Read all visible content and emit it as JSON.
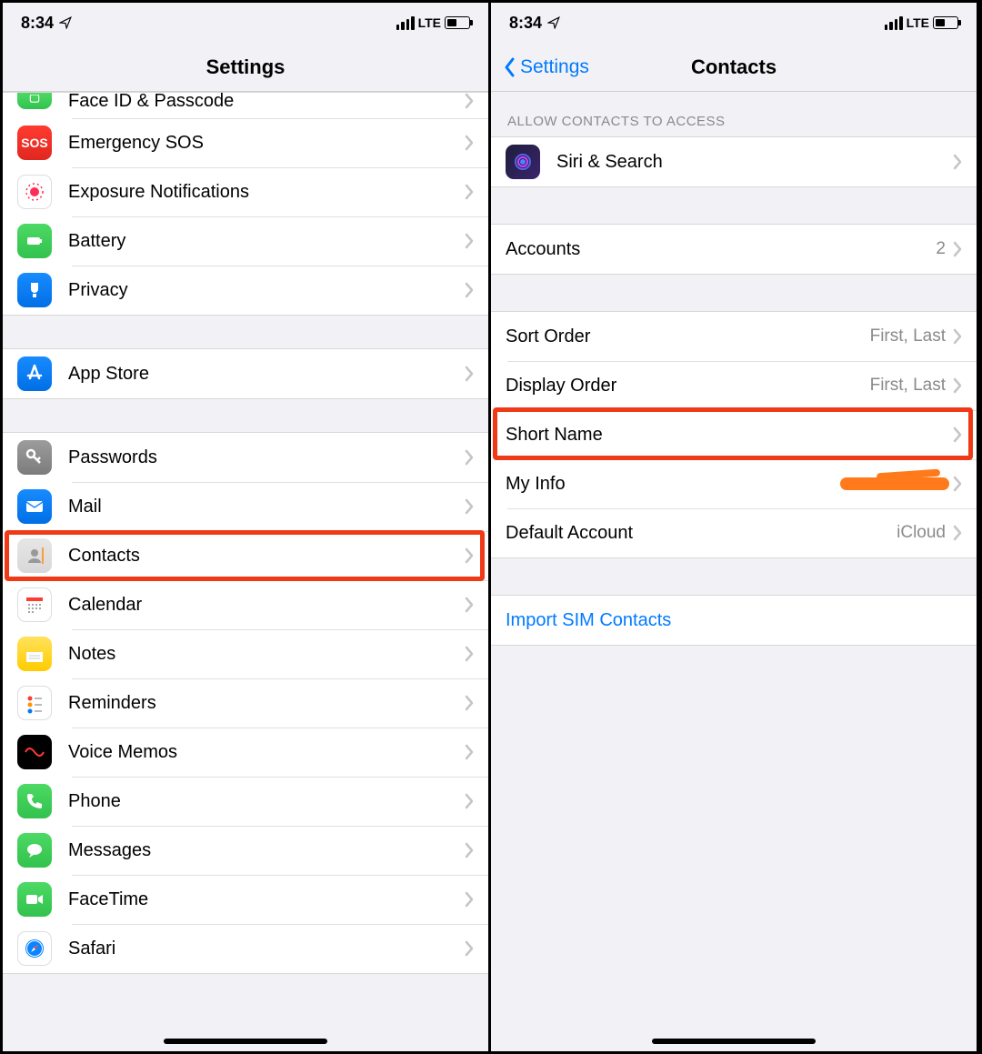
{
  "status": {
    "time": "8:34",
    "network": "LTE"
  },
  "left": {
    "title": "Settings",
    "items": [
      {
        "label": "Face ID & Passcode",
        "cut": true
      },
      {
        "label": "Emergency SOS"
      },
      {
        "label": "Exposure Notifications"
      },
      {
        "label": "Battery"
      },
      {
        "label": "Privacy"
      }
    ],
    "group2": [
      {
        "label": "App Store"
      }
    ],
    "group3": [
      {
        "label": "Passwords"
      },
      {
        "label": "Mail"
      },
      {
        "label": "Contacts",
        "highlighted": true
      },
      {
        "label": "Calendar"
      },
      {
        "label": "Notes"
      },
      {
        "label": "Reminders"
      },
      {
        "label": "Voice Memos"
      },
      {
        "label": "Phone"
      },
      {
        "label": "Messages"
      },
      {
        "label": "FaceTime"
      },
      {
        "label": "Safari"
      }
    ]
  },
  "right": {
    "back": "Settings",
    "title": "Contacts",
    "header1": "Allow Contacts to Access",
    "siri": "Siri & Search",
    "accounts": {
      "label": "Accounts",
      "value": "2"
    },
    "group3": [
      {
        "label": "Sort Order",
        "value": "First, Last"
      },
      {
        "label": "Display Order",
        "value": "First, Last"
      },
      {
        "label": "Short Name",
        "value": "",
        "highlighted": true
      },
      {
        "label": "My Info",
        "value": "",
        "redacted": true
      },
      {
        "label": "Default Account",
        "value": "iCloud"
      }
    ],
    "import": "Import SIM Contacts"
  }
}
